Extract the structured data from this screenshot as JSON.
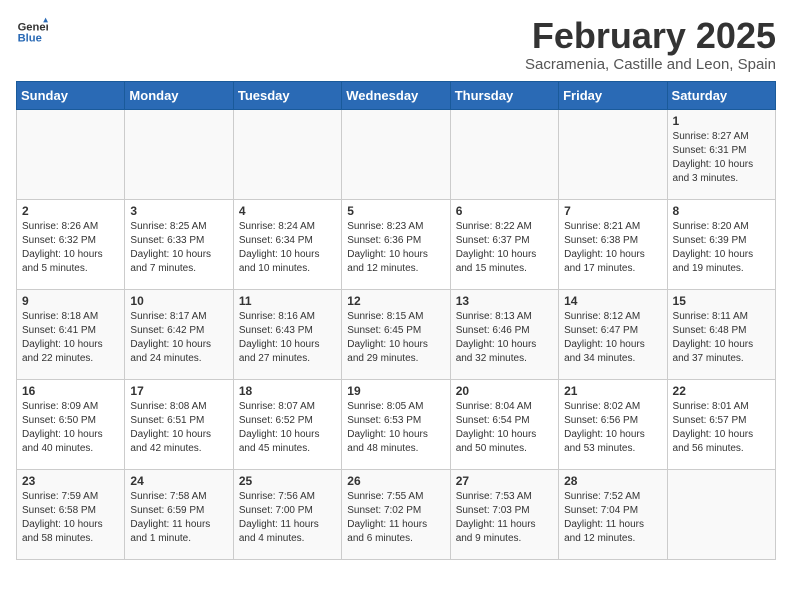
{
  "logo": {
    "text_general": "General",
    "text_blue": "Blue"
  },
  "title": "February 2025",
  "subtitle": "Sacramenia, Castille and Leon, Spain",
  "weekdays": [
    "Sunday",
    "Monday",
    "Tuesday",
    "Wednesday",
    "Thursday",
    "Friday",
    "Saturday"
  ],
  "weeks": [
    [
      {
        "day": "",
        "info": ""
      },
      {
        "day": "",
        "info": ""
      },
      {
        "day": "",
        "info": ""
      },
      {
        "day": "",
        "info": ""
      },
      {
        "day": "",
        "info": ""
      },
      {
        "day": "",
        "info": ""
      },
      {
        "day": "1",
        "info": "Sunrise: 8:27 AM\nSunset: 6:31 PM\nDaylight: 10 hours\nand 3 minutes."
      }
    ],
    [
      {
        "day": "2",
        "info": "Sunrise: 8:26 AM\nSunset: 6:32 PM\nDaylight: 10 hours\nand 5 minutes."
      },
      {
        "day": "3",
        "info": "Sunrise: 8:25 AM\nSunset: 6:33 PM\nDaylight: 10 hours\nand 7 minutes."
      },
      {
        "day": "4",
        "info": "Sunrise: 8:24 AM\nSunset: 6:34 PM\nDaylight: 10 hours\nand 10 minutes."
      },
      {
        "day": "5",
        "info": "Sunrise: 8:23 AM\nSunset: 6:36 PM\nDaylight: 10 hours\nand 12 minutes."
      },
      {
        "day": "6",
        "info": "Sunrise: 8:22 AM\nSunset: 6:37 PM\nDaylight: 10 hours\nand 15 minutes."
      },
      {
        "day": "7",
        "info": "Sunrise: 8:21 AM\nSunset: 6:38 PM\nDaylight: 10 hours\nand 17 minutes."
      },
      {
        "day": "8",
        "info": "Sunrise: 8:20 AM\nSunset: 6:39 PM\nDaylight: 10 hours\nand 19 minutes."
      }
    ],
    [
      {
        "day": "9",
        "info": "Sunrise: 8:18 AM\nSunset: 6:41 PM\nDaylight: 10 hours\nand 22 minutes."
      },
      {
        "day": "10",
        "info": "Sunrise: 8:17 AM\nSunset: 6:42 PM\nDaylight: 10 hours\nand 24 minutes."
      },
      {
        "day": "11",
        "info": "Sunrise: 8:16 AM\nSunset: 6:43 PM\nDaylight: 10 hours\nand 27 minutes."
      },
      {
        "day": "12",
        "info": "Sunrise: 8:15 AM\nSunset: 6:45 PM\nDaylight: 10 hours\nand 29 minutes."
      },
      {
        "day": "13",
        "info": "Sunrise: 8:13 AM\nSunset: 6:46 PM\nDaylight: 10 hours\nand 32 minutes."
      },
      {
        "day": "14",
        "info": "Sunrise: 8:12 AM\nSunset: 6:47 PM\nDaylight: 10 hours\nand 34 minutes."
      },
      {
        "day": "15",
        "info": "Sunrise: 8:11 AM\nSunset: 6:48 PM\nDaylight: 10 hours\nand 37 minutes."
      }
    ],
    [
      {
        "day": "16",
        "info": "Sunrise: 8:09 AM\nSunset: 6:50 PM\nDaylight: 10 hours\nand 40 minutes."
      },
      {
        "day": "17",
        "info": "Sunrise: 8:08 AM\nSunset: 6:51 PM\nDaylight: 10 hours\nand 42 minutes."
      },
      {
        "day": "18",
        "info": "Sunrise: 8:07 AM\nSunset: 6:52 PM\nDaylight: 10 hours\nand 45 minutes."
      },
      {
        "day": "19",
        "info": "Sunrise: 8:05 AM\nSunset: 6:53 PM\nDaylight: 10 hours\nand 48 minutes."
      },
      {
        "day": "20",
        "info": "Sunrise: 8:04 AM\nSunset: 6:54 PM\nDaylight: 10 hours\nand 50 minutes."
      },
      {
        "day": "21",
        "info": "Sunrise: 8:02 AM\nSunset: 6:56 PM\nDaylight: 10 hours\nand 53 minutes."
      },
      {
        "day": "22",
        "info": "Sunrise: 8:01 AM\nSunset: 6:57 PM\nDaylight: 10 hours\nand 56 minutes."
      }
    ],
    [
      {
        "day": "23",
        "info": "Sunrise: 7:59 AM\nSunset: 6:58 PM\nDaylight: 10 hours\nand 58 minutes."
      },
      {
        "day": "24",
        "info": "Sunrise: 7:58 AM\nSunset: 6:59 PM\nDaylight: 11 hours\nand 1 minute."
      },
      {
        "day": "25",
        "info": "Sunrise: 7:56 AM\nSunset: 7:00 PM\nDaylight: 11 hours\nand 4 minutes."
      },
      {
        "day": "26",
        "info": "Sunrise: 7:55 AM\nSunset: 7:02 PM\nDaylight: 11 hours\nand 6 minutes."
      },
      {
        "day": "27",
        "info": "Sunrise: 7:53 AM\nSunset: 7:03 PM\nDaylight: 11 hours\nand 9 minutes."
      },
      {
        "day": "28",
        "info": "Sunrise: 7:52 AM\nSunset: 7:04 PM\nDaylight: 11 hours\nand 12 minutes."
      },
      {
        "day": "",
        "info": ""
      }
    ]
  ]
}
